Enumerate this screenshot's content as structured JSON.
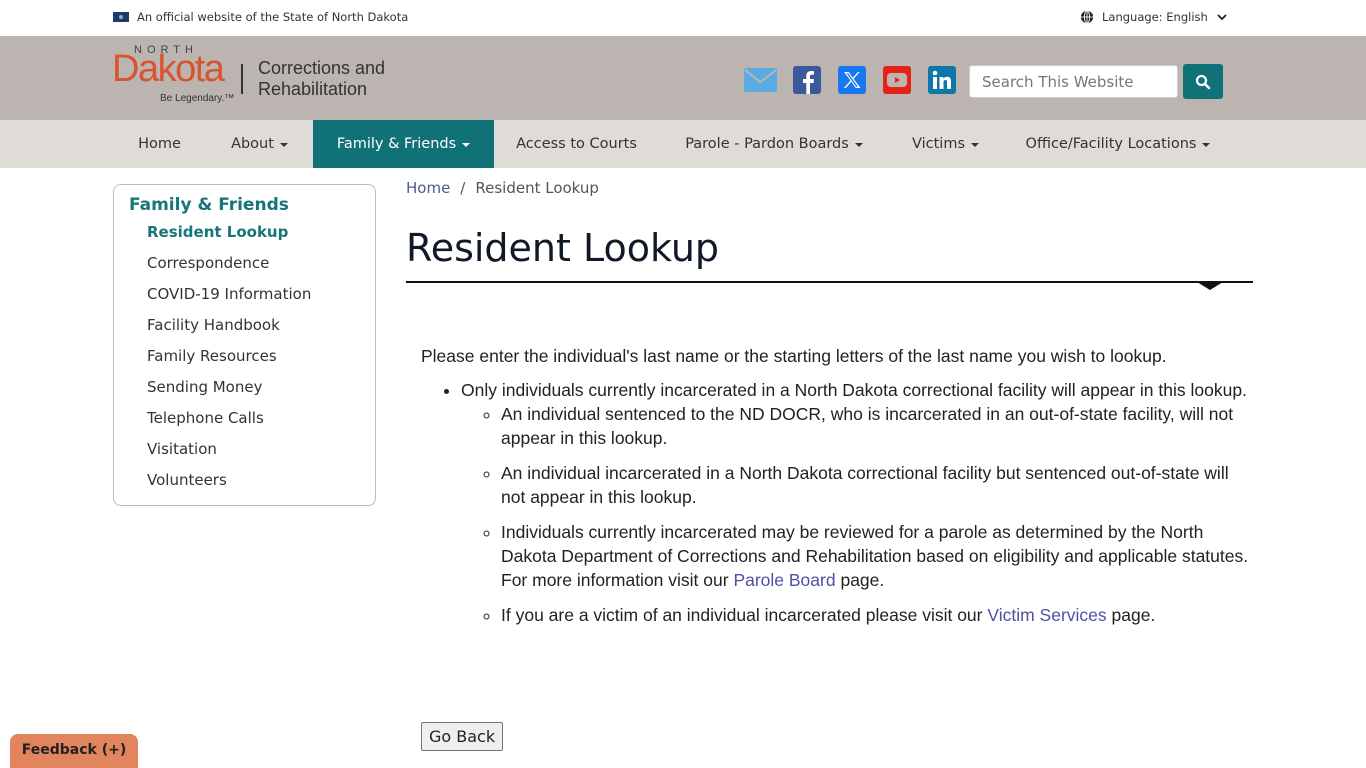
{
  "official_bar": {
    "text": "An official website of the State of North Dakota",
    "language_label": "Language: English"
  },
  "header": {
    "logo": {
      "north": "NORTH",
      "dakota": "Dakota",
      "tagline": "Be Legendary.™",
      "agency_line1": "Corrections and",
      "agency_line2": "Rehabilitation"
    },
    "social": [
      {
        "name": "email",
        "color": "#5aabe3"
      },
      {
        "name": "facebook",
        "color": "#3b5998"
      },
      {
        "name": "x-twitter",
        "color": "#1877f2"
      },
      {
        "name": "youtube",
        "color": "#e62117"
      },
      {
        "name": "linkedin",
        "color": "#0e76a8"
      }
    ],
    "search_placeholder": "Search This Website"
  },
  "nav": {
    "items": [
      {
        "label": "Home",
        "dropdown": false
      },
      {
        "label": "About",
        "dropdown": true
      },
      {
        "label": "Family & Friends",
        "dropdown": true,
        "active": true
      },
      {
        "label": "Access to Courts",
        "dropdown": false
      },
      {
        "label": "Parole - Pardon Boards",
        "dropdown": true
      },
      {
        "label": "Victims",
        "dropdown": true
      },
      {
        "label": "Office/Facility Locations",
        "dropdown": true
      }
    ]
  },
  "sidebar": {
    "title": "Family & Friends",
    "items": [
      {
        "label": "Resident Lookup",
        "current": true
      },
      {
        "label": "Correspondence"
      },
      {
        "label": "COVID-19 Information"
      },
      {
        "label": "Facility Handbook"
      },
      {
        "label": "Family Resources"
      },
      {
        "label": "Sending Money"
      },
      {
        "label": "Telephone Calls"
      },
      {
        "label": "Visitation"
      },
      {
        "label": "Volunteers"
      }
    ]
  },
  "breadcrumb": {
    "home": "Home",
    "separator": "/",
    "current": "Resident Lookup"
  },
  "page": {
    "title": "Resident Lookup",
    "intro": "Please enter the individual's last name or the starting letters of the last name you wish to lookup.",
    "bullet1": "Only individuals currently incarcerated in a North Dakota correctional facility will appear in this lookup.",
    "sub1": "An individual sentenced to the ND DOCR, who is incarcerated in an out-of-state facility, will not appear in this lookup.",
    "sub2": "An individual incarcerated in a North Dakota correctional facility but sentenced out-of-state will not appear in this lookup.",
    "sub3_before": "Individuals currently incarcerated may be reviewed for a parole as determined by the North Dakota Department of Corrections and Rehabilitation based on eligibility and applicable statutes. For more information visit our ",
    "sub3_link": "Parole Board",
    "sub3_after": " page.",
    "sub4_before": "If you are a victim of an individual incarcerated please visit our ",
    "sub4_link": "Victim Services",
    "sub4_after": " page.",
    "go_back": "Go Back"
  },
  "feedback": {
    "label": "Feedback (+)"
  },
  "colors": {
    "brand_teal": "#107177",
    "header_bg": "#bbb4b1",
    "nav_bg": "#dfdbd7",
    "dakota_orange": "#d9542e",
    "feedback_bg": "#e2845e",
    "link": "#4f4fa8"
  }
}
